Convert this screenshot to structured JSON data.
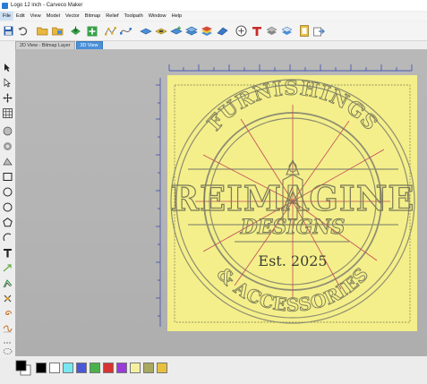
{
  "window": {
    "title": "Logo 12 inch - Carveco Maker"
  },
  "menu": [
    "File",
    "Edit",
    "View",
    "Model",
    "Vector",
    "Bitmap",
    "Relief",
    "Toolpath",
    "Window",
    "Help"
  ],
  "tabs": [
    "2D View - Bitmap Layer",
    "3D View"
  ],
  "toolbar_icons": [
    "save-icon",
    "undo-icon",
    "open-folder-icon",
    "import-image-icon",
    "export-icon",
    "add-icon",
    "node-edit-icon",
    "smooth-icon",
    "relief-plane-icon",
    "relief-sweep-icon",
    "relief-add-icon",
    "relief-layer-icon",
    "relief-stack-icon",
    "relief-blue-icon",
    "relief-reset-icon",
    "text-relief-icon",
    "layers-icon",
    "bitmap-trace-icon",
    "vector-clip-icon",
    "export-relief-icon"
  ],
  "tool_icons": [
    "select-icon",
    "node-select-icon",
    "transform-icon",
    "grid-icon",
    "shape-a-icon",
    "shape-b-icon",
    "shape-c-icon",
    "rectangle-icon",
    "ellipse-icon",
    "circle-icon",
    "polygon-icon",
    "arc-icon",
    "text-icon",
    "arrow-tool-icon",
    "offset-icon",
    "weld-icon",
    "spiral-icon",
    "polyline-icon",
    "cut-icon",
    "lasso-icon",
    "bitmap-tool-icon"
  ],
  "logo": {
    "top_text": "FURNISHINGS",
    "main_text": "REIMAGINE",
    "sub_text": "DESIGNS",
    "est": "Est. 2025",
    "bottom_text": "& ACCESSORIES"
  },
  "colors": {
    "accent": "#4a90d9",
    "canvas_bg": "#b6b6b6",
    "sheet": "#f4ef8a",
    "ruler_blue": "#2b3fae",
    "radial_lines": "#c24a5a"
  },
  "palette": [
    "#000000",
    "#ffffff",
    "#78e8f0",
    "#4a58d8",
    "#4ab24a",
    "#d83232",
    "#9a3ad8",
    "#f4f0a0",
    "#a8a860",
    "#e8c040"
  ]
}
